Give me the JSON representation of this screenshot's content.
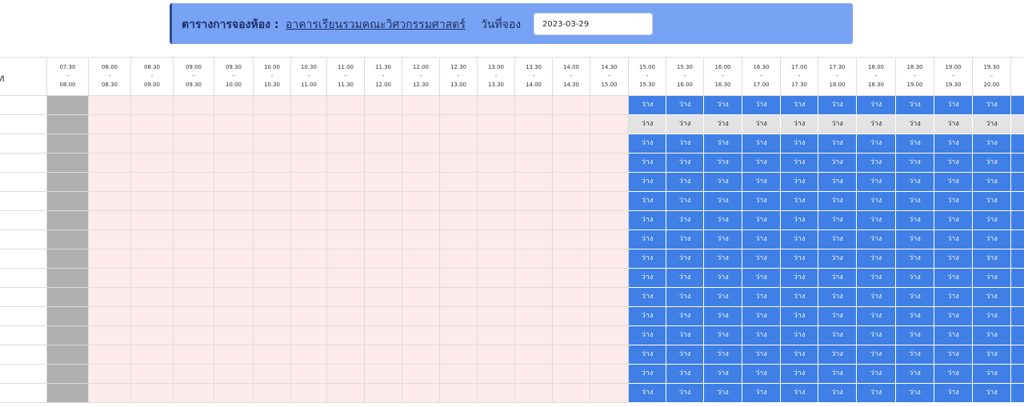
{
  "header": {
    "title": "ตารางการจองห้อง :",
    "building": "อาคารเรียนรวมคณะวิศวกรรมศาสตร์",
    "date_label": "วันที่จอง",
    "date_value": "2023-03-29"
  },
  "grid": {
    "first_column_header": "ท",
    "status_free": "ว่าง",
    "row_count": 16,
    "muted_row_index": 1,
    "past_slot_count": 15,
    "time_slots": [
      {
        "start": "07.30",
        "sep": "-",
        "end": "08.00"
      },
      {
        "start": "08.00",
        "sep": "-",
        "end": "08.30"
      },
      {
        "start": "08.30",
        "sep": "-",
        "end": "09.00"
      },
      {
        "start": "09.00",
        "sep": "-",
        "end": "09.30"
      },
      {
        "start": "09.30",
        "sep": "-",
        "end": "10.00"
      },
      {
        "start": "10.00",
        "sep": "-",
        "end": "10.30"
      },
      {
        "start": "10.30",
        "sep": "-",
        "end": "11.00"
      },
      {
        "start": "11.00",
        "sep": "-",
        "end": "11.30"
      },
      {
        "start": "11.30",
        "sep": "-",
        "end": "12.00"
      },
      {
        "start": "12.00",
        "sep": "-",
        "end": "12.30"
      },
      {
        "start": "12.30",
        "sep": "-",
        "end": "13.00"
      },
      {
        "start": "13.00",
        "sep": "-",
        "end": "13.30"
      },
      {
        "start": "13.30",
        "sep": "-",
        "end": "14.00"
      },
      {
        "start": "14.00",
        "sep": "-",
        "end": "14.30"
      },
      {
        "start": "14.30",
        "sep": "-",
        "end": "15.00"
      },
      {
        "start": "15.00",
        "sep": "-",
        "end": "15.30"
      },
      {
        "start": "15.30",
        "sep": "-",
        "end": "16.00"
      },
      {
        "start": "16.00",
        "sep": "-",
        "end": "16.30"
      },
      {
        "start": "16.30",
        "sep": "-",
        "end": "17.00"
      },
      {
        "start": "17.00",
        "sep": "-",
        "end": "17.30"
      },
      {
        "start": "17.30",
        "sep": "-",
        "end": "18.00"
      },
      {
        "start": "18.00",
        "sep": "-",
        "end": "18.30"
      },
      {
        "start": "18.30",
        "sep": "-",
        "end": "19.00"
      },
      {
        "start": "19.00",
        "sep": "-",
        "end": "19.30"
      },
      {
        "start": "19.30",
        "sep": "-",
        "end": "20.00"
      }
    ]
  },
  "colors": {
    "header_bg": "#78a3f4",
    "free_slot": "#3f7fe6",
    "past_slot": "#fdeaea",
    "past_first_slot": "#b0b0b0",
    "muted_slot": "#e3e3e3"
  }
}
